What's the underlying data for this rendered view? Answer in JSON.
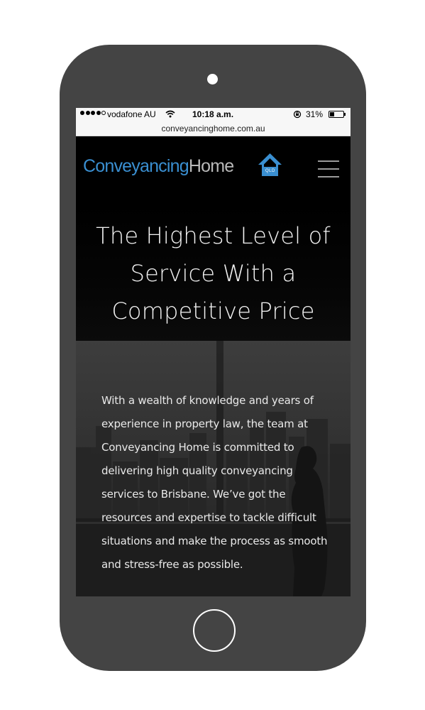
{
  "status_bar": {
    "carrier": "vodafone AU",
    "time": "10:18 a.m.",
    "battery_percent": "31%",
    "battery_level": 0.31,
    "signal_dots_filled": 4,
    "signal_dots_total": 5
  },
  "browser": {
    "url": "conveyancinghome.com.au"
  },
  "header": {
    "logo_word1": "Conveyancing",
    "logo_word2": "Home",
    "logo_badge": "QLD",
    "menu_icon": "hamburger-menu-icon"
  },
  "hero": {
    "title": "The Highest Level of Service With a Competitive Price"
  },
  "intro": {
    "text": "With a wealth of knowledge and years of experience in property law, the team at Conveyancing Home is committed to delivering high quality conveyancing services to Brisbane. We’ve got the resources and expertise to tackle difficult situations and make the process as smooth and stress-free as possible."
  },
  "colors": {
    "phone_body": "#444444",
    "brand_blue": "#3a8fd1",
    "logo_grey": "#b9b9b9",
    "screen_bg": "#000000"
  }
}
